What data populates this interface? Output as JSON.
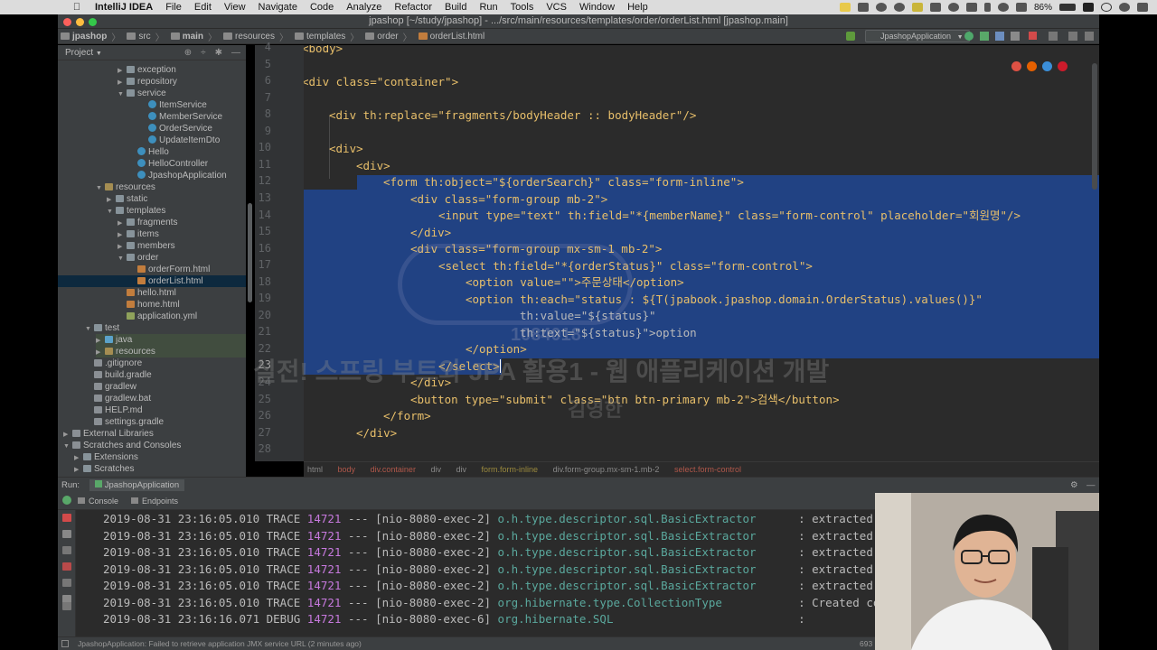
{
  "menubar": {
    "app_name": "IntelliJ IDEA",
    "items": [
      "File",
      "Edit",
      "View",
      "Navigate",
      "Code",
      "Analyze",
      "Refactor",
      "Build",
      "Run",
      "Tools",
      "VCS",
      "Window",
      "Help"
    ],
    "battery": "86%"
  },
  "window": {
    "title": "jpashop [~/study/jpashop] - .../src/main/resources/templates/order/orderList.html [jpashop.main]"
  },
  "navbar": {
    "crumbs": [
      "jpashop",
      "src",
      "main",
      "resources",
      "templates",
      "order",
      "orderList.html"
    ],
    "run_config": "JpashopApplication"
  },
  "project_panel": {
    "title": "Project",
    "tree": [
      {
        "label": "exception",
        "icon": "folder",
        "arrow": "▶"
      },
      {
        "label": "repository",
        "icon": "folder",
        "arrow": "▶"
      },
      {
        "label": "service",
        "icon": "folder",
        "arrow": "▼"
      },
      {
        "label": "ItemService",
        "icon": "class",
        "arrow": ""
      },
      {
        "label": "MemberService",
        "icon": "class",
        "arrow": ""
      },
      {
        "label": "OrderService",
        "icon": "class",
        "arrow": ""
      },
      {
        "label": "UpdateItemDto",
        "icon": "class",
        "arrow": ""
      },
      {
        "label": "Hello",
        "icon": "class",
        "arrow": ""
      },
      {
        "label": "HelloController",
        "icon": "class",
        "arrow": ""
      },
      {
        "label": "JpashopApplication",
        "icon": "class",
        "arrow": ""
      },
      {
        "label": "resources",
        "icon": "resources",
        "arrow": "▼"
      },
      {
        "label": "static",
        "icon": "folder",
        "arrow": "▶"
      },
      {
        "label": "templates",
        "icon": "folder",
        "arrow": "▼"
      },
      {
        "label": "fragments",
        "icon": "folder",
        "arrow": "▶"
      },
      {
        "label": "items",
        "icon": "folder",
        "arrow": "▶"
      },
      {
        "label": "members",
        "icon": "folder",
        "arrow": "▶"
      },
      {
        "label": "order",
        "icon": "folder",
        "arrow": "▼"
      },
      {
        "label": "orderForm.html",
        "icon": "html",
        "arrow": ""
      },
      {
        "label": "orderList.html",
        "icon": "html",
        "arrow": ""
      },
      {
        "label": "hello.html",
        "icon": "html",
        "arrow": ""
      },
      {
        "label": "home.html",
        "icon": "html",
        "arrow": ""
      },
      {
        "label": "application.yml",
        "icon": "yml",
        "arrow": ""
      },
      {
        "label": "test",
        "icon": "folder",
        "arrow": "▼"
      },
      {
        "label": "java",
        "icon": "java",
        "arrow": "▶"
      },
      {
        "label": "resources",
        "icon": "resources",
        "arrow": "▶"
      },
      {
        "label": ".gitignore",
        "icon": "file",
        "arrow": ""
      },
      {
        "label": "build.gradle",
        "icon": "file",
        "arrow": ""
      },
      {
        "label": "gradlew",
        "icon": "file",
        "arrow": ""
      },
      {
        "label": "gradlew.bat",
        "icon": "file",
        "arrow": ""
      },
      {
        "label": "HELP.md",
        "icon": "file",
        "arrow": ""
      },
      {
        "label": "settings.gradle",
        "icon": "file",
        "arrow": ""
      },
      {
        "label": "External Libraries",
        "icon": "lib",
        "arrow": "▶"
      },
      {
        "label": "Scratches and Consoles",
        "icon": "lib",
        "arrow": "▼"
      },
      {
        "label": "Extensions",
        "icon": "folder",
        "arrow": "▶"
      },
      {
        "label": "Scratches",
        "icon": "folder",
        "arrow": "▶"
      }
    ]
  },
  "editor": {
    "line_numbers": [
      "4",
      "5",
      "6",
      "7",
      "8",
      "9",
      "10",
      "11",
      "12",
      "13",
      "14",
      "15",
      "16",
      "17",
      "18",
      "19",
      "20",
      "21",
      "22",
      "23",
      "24",
      "25",
      "26",
      "27",
      "28"
    ],
    "line0": "<body>",
    "line6": "<div class=\"container\">",
    "line8": "<div th:replace=\"fragments/bodyHeader :: bodyHeader\"/>",
    "line10": "<div>",
    "line11": "<div>",
    "line12": "<form th:object=\"${orderSearch}\" class=\"form-inline\">",
    "line13": "<div class=\"form-group mb-2\">",
    "line14": "<input type=\"text\" th:field=\"*{memberName}\" class=\"form-control\" placeholder=\"회원명\"/>",
    "line15": "</div>",
    "line16": "<div class=\"form-group mx-sm-1 mb-2\">",
    "line17": "<select th:field=\"*{orderStatus}\" class=\"form-control\">",
    "line18": "<option value=\"\">주문상태</option>",
    "line19": "<option th:each=\"status : ${T(jpabook.jpashop.domain.OrderStatus).values()}\"",
    "line20": "th:value=\"${status}\"",
    "line21": "th:text=\"${status}\">option",
    "line22": "</option>",
    "line23": "</select>",
    "line24": "</div>",
    "line25": "<button type=\"submit\" class=\"btn btn-primary mb-2\">검색</button>",
    "line26": "</form>",
    "line27": "</div>",
    "breadcrumb": [
      "html",
      "body",
      "div.container",
      "div",
      "div",
      "form.form-inline",
      "div.form-group.mx-sm-1.mb-2",
      "select.form-control"
    ]
  },
  "watermark": {
    "title": "실전! 스프링 부트와 JPA 활용1 - 웹 애플리케이션 개발",
    "author": "김영한",
    "id": "1084018"
  },
  "run_panel": {
    "label": "Run:",
    "config": "JpashopApplication",
    "tabs": [
      "Console",
      "Endpoints"
    ]
  },
  "console": {
    "lines": [
      {
        "ts": "2019-08-31 23:16:05.010",
        "level": "TRACE",
        "pid": "14721",
        "thread": "--- [nio-8080-exec-2]",
        "logger": "o.h.type.descriptor.sql.BasicExtractor",
        "msg": ": extracted va"
      },
      {
        "ts": "2019-08-31 23:16:05.010",
        "level": "TRACE",
        "pid": "14721",
        "thread": "--- [nio-8080-exec-2]",
        "logger": "o.h.type.descriptor.sql.BasicExtractor",
        "msg": ": extracted va"
      },
      {
        "ts": "2019-08-31 23:16:05.010",
        "level": "TRACE",
        "pid": "14721",
        "thread": "--- [nio-8080-exec-2]",
        "logger": "o.h.type.descriptor.sql.BasicExtractor",
        "msg": ": extracted va"
      },
      {
        "ts": "2019-08-31 23:16:05.010",
        "level": "TRACE",
        "pid": "14721",
        "thread": "--- [nio-8080-exec-2]",
        "logger": "o.h.type.descriptor.sql.BasicExtractor",
        "msg": ": extracted va"
      },
      {
        "ts": "2019-08-31 23:16:05.010",
        "level": "TRACE",
        "pid": "14721",
        "thread": "--- [nio-8080-exec-2]",
        "logger": "o.h.type.descriptor.sql.BasicExtractor",
        "msg": ": extracted va"
      },
      {
        "ts": "2019-08-31 23:16:05.010",
        "level": "TRACE",
        "pid": "14721",
        "thread": "--- [nio-8080-exec-2]",
        "logger": "org.hibernate.type.CollectionType",
        "msg": ": Created coll"
      },
      {
        "ts": "2019-08-31 23:16:16.071",
        "level": "DEBUG",
        "pid": "14721",
        "thread": "--- [nio-8080-exec-6]",
        "logger": "org.hibernate.SQL",
        "msg": ":"
      }
    ]
  },
  "statusbar": {
    "message": "JpashopApplication: Failed to retrieve application JMX service URL (2 minutes ago)",
    "position": "693"
  },
  "colors": {
    "selection": "#214283",
    "tag": "#e8bf6a",
    "string": "#a5c25c",
    "editor_bg": "#2b2b2b",
    "panel_bg": "#3c3f41"
  }
}
